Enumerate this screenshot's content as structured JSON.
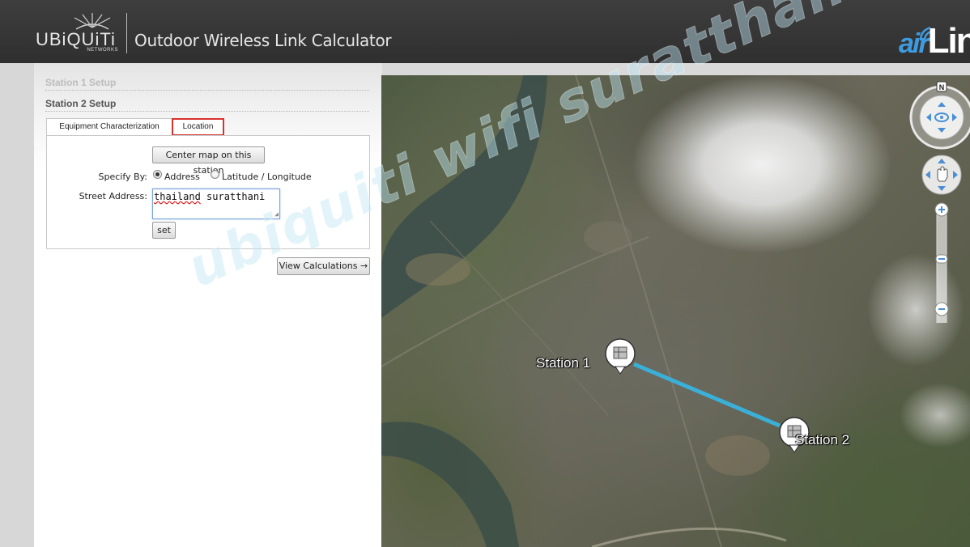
{
  "brand": {
    "logo_text": "UBiQUiTi",
    "logo_sub": "NETWORKS",
    "app_title": "Outdoor Wireless Link Calculator",
    "product_air": "air",
    "product_link": "Link"
  },
  "sections": {
    "station1": "Station 1 Setup",
    "station2": "Station 2 Setup"
  },
  "tabs": [
    {
      "label": "Equipment Characterization",
      "selected": false
    },
    {
      "label": "Location",
      "selected": true
    }
  ],
  "location_form": {
    "center_button": "Center map on this station",
    "specify_by_label": "Specify By:",
    "option_address": "Address",
    "option_latlong": "Latitude / Longitude",
    "selected_option": "Address",
    "street_label": "Street Address:",
    "street_value_part1": "thailand",
    "street_value_part2": " suratthani",
    "set_button": "set"
  },
  "view_calc_button": "View Calculations →",
  "map": {
    "station1_label": "Station 1",
    "station2_label": "Station 2",
    "compass_north": "N",
    "link_color": "#3ab0d8"
  },
  "watermark": "ubiquiti wifi suratthani"
}
